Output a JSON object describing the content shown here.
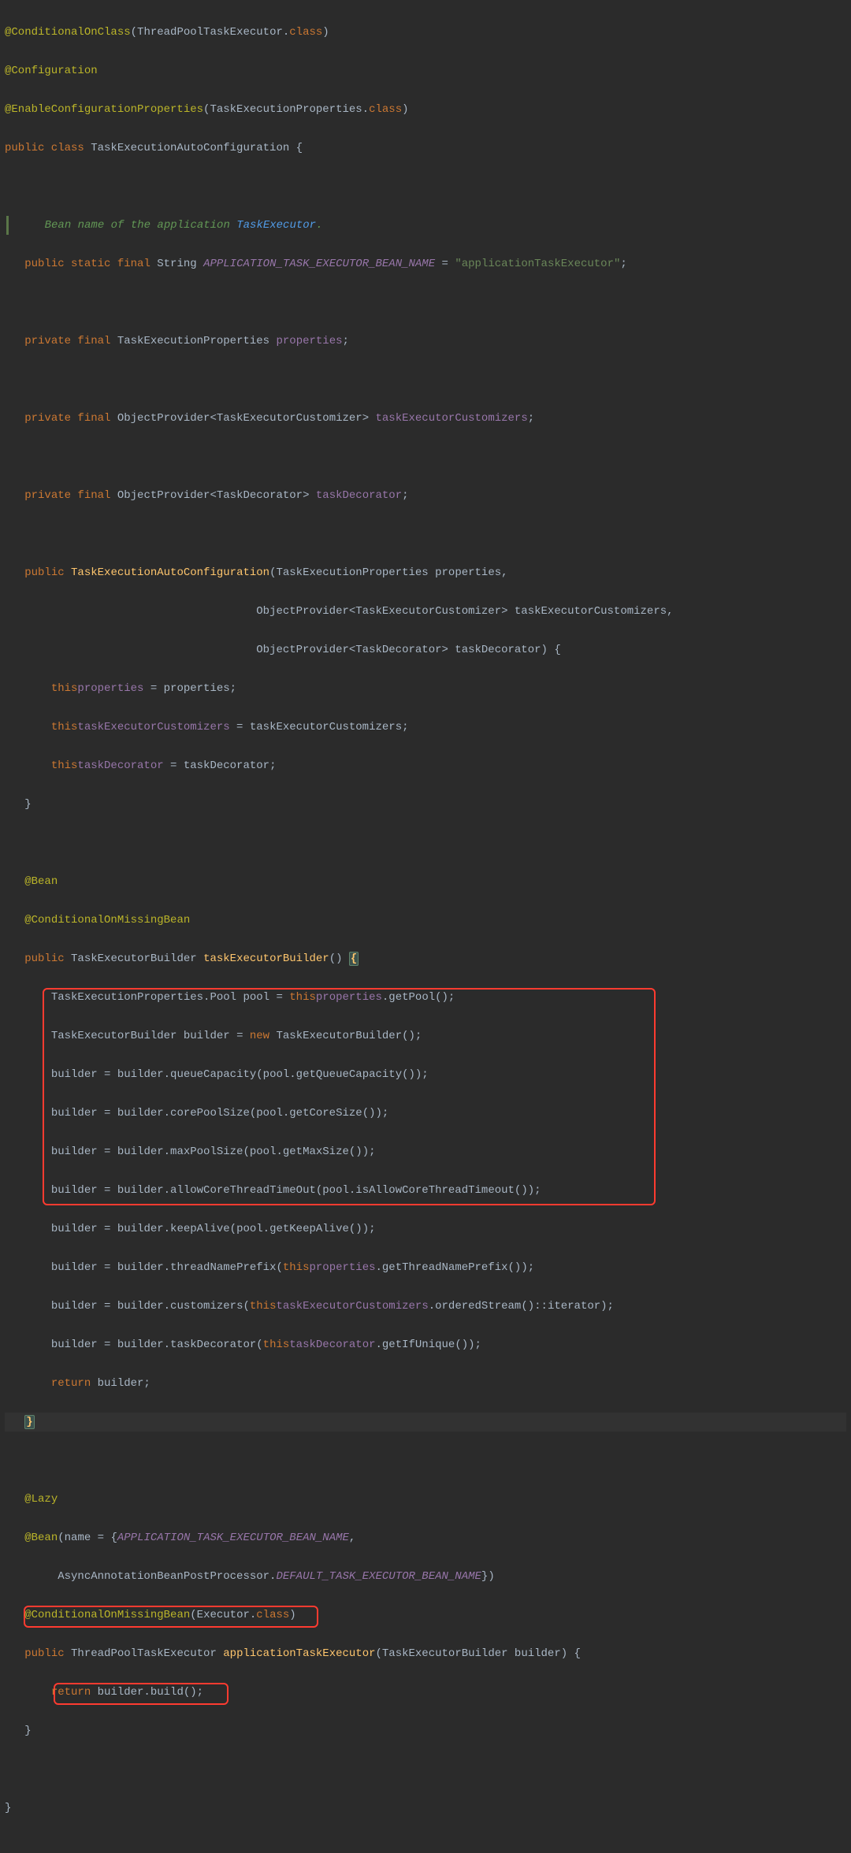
{
  "code": {
    "l1": {
      "a": "@ConditionalOnClass",
      "p1": "(ThreadPoolTaskExecutor.",
      "cls": "class",
      "p2": ")"
    },
    "l2": {
      "a": "@Configuration"
    },
    "l3": {
      "a": "@EnableConfigurationProperties",
      "p1": "(TaskExecutionProperties.",
      "cls": "class",
      "p2": ")"
    },
    "l4": {
      "k1": "public class ",
      "name": "TaskExecutionAutoConfiguration",
      "b": " {"
    },
    "l5": "",
    "doc": {
      "pre": "Bean name of the application ",
      "link": "TaskExecutor",
      "post": "."
    },
    "l7": {
      "mods": "public static final ",
      "type": "String ",
      "name": "APPLICATION_TASK_EXECUTOR_BEAN_NAME",
      "eq": " = ",
      "str": "\"applicationTaskExecutor\"",
      "sc": ";"
    },
    "l8": "",
    "l9": {
      "mods": "private final ",
      "type": "TaskExecutionProperties ",
      "name": "properties",
      "sc": ";"
    },
    "l10": "",
    "l11": {
      "mods": "private final ",
      "type": "ObjectProvider<TaskExecutorCustomizer> ",
      "name": "taskExecutorCustomizers",
      "sc": ";"
    },
    "l12": "",
    "l13": {
      "mods": "private final ",
      "type": "ObjectProvider<TaskDecorator> ",
      "name": "taskDecorator",
      "sc": ";"
    },
    "l14": "",
    "ctor1": {
      "mods": "public ",
      "name": "TaskExecutionAutoConfiguration",
      "sig": "(TaskExecutionProperties properties,"
    },
    "ctor2": "                                      ObjectProvider<TaskExecutorCustomizer> taskExecutorCustomizers,",
    "ctor3": "                                      ObjectProvider<TaskDecorator> taskDecorator) {",
    "ctor4": {
      "th": "this",
      ".": ".",
      "f": "properties",
      "eq": " = properties;"
    },
    "ctor5": {
      "th": "this",
      ".": ".",
      "f": "taskExecutorCustomizers",
      "eq": " = taskExecutorCustomizers;"
    },
    "ctor6": {
      "th": "this",
      ".": ".",
      "f": "taskDecorator",
      "eq": " = taskDecorator;"
    },
    "ctor7": "}",
    "l22": "",
    "b1": {
      "a": "@Bean"
    },
    "b2": {
      "a": "@ConditionalOnMissingBean"
    },
    "b3": {
      "mods": "public ",
      "type": "TaskExecutorBuilder ",
      "name": "taskExecutorBuilder",
      "p": "() ",
      "br": "{"
    },
    "m1": {
      "pre": "    TaskExecutionProperties.Pool pool = ",
      "th": "this",
      ".": ".",
      "f": "properties",
      "post": ".getPool();"
    },
    "m2": {
      "pre": "    TaskExecutorBuilder builder = ",
      "nw": "new ",
      "post": "TaskExecutorBuilder();"
    },
    "m3": "    builder = builder.queueCapacity(pool.getQueueCapacity());",
    "m4": "    builder = builder.corePoolSize(pool.getCoreSize());",
    "m5": "    builder = builder.maxPoolSize(pool.getMaxSize());",
    "m6": "    builder = builder.allowCoreThreadTimeOut(pool.isAllowCoreThreadTimeout());",
    "m7": "    builder = builder.keepAlive(pool.getKeepAlive());",
    "m8": {
      "pre": "    builder = builder.threadNamePrefix(",
      "th": "this",
      ".": ".",
      "f": "properties",
      "post": ".getThreadNamePrefix());"
    },
    "m9": {
      "pre": "    builder = builder.customizers(",
      "th": "this",
      ".": ".",
      "f": "taskExecutorCustomizers",
      "post": ".orderedStream()::iterator);"
    },
    "m10": {
      "pre": "    builder = builder.taskDecorator(",
      "th": "this",
      ".": ".",
      "f": "taskDecorator",
      "post": ".getIfUnique());"
    },
    "m11": {
      "k": "return ",
      "v": "builder;"
    },
    "m12": "}",
    "l36": "",
    "z1": {
      "a": "@Lazy"
    },
    "z2": {
      "a": "@Bean",
      "p1": "(name = {",
      "c1": "APPLICATION_TASK_EXECUTOR_BEAN_NAME",
      "p2": ","
    },
    "z3": {
      "pre": "        AsyncAnnotationBeanPostProcessor.",
      "c": "DEFAULT_TASK_EXECUTOR_BEAN_NAME",
      "post": "})"
    },
    "z4": {
      "a": "@ConditionalOnMissingBean",
      "p1": "(Executor.",
      "cls": "class",
      "p2": ")"
    },
    "z5": {
      "mods": "public ",
      "type": "ThreadPoolTaskExecutor ",
      "name": "applicationTaskExecutor",
      "sig": "(TaskExecutorBuilder builder) {"
    },
    "z6": {
      "k": "return ",
      "v": "builder.build();"
    },
    "z7": "}",
    "l44": "",
    "end": "}"
  }
}
